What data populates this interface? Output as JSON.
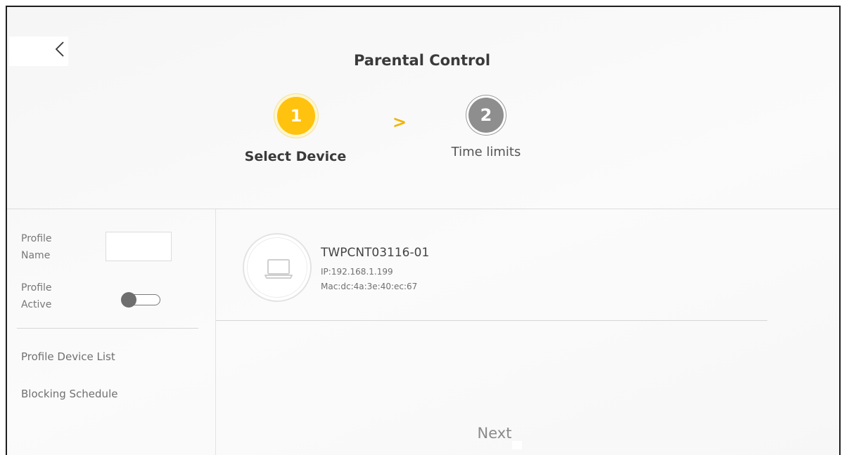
{
  "header": {
    "title": "Parental Control",
    "back_icon": "chevron-left-icon"
  },
  "steps": [
    {
      "number": "1",
      "label": "Select Device",
      "state": "active",
      "color": "#ffc20e"
    },
    {
      "number": "2",
      "label": "Time limits",
      "state": "inactive",
      "color": "#8e8e8e"
    }
  ],
  "step_separator": ">",
  "sidebar": {
    "profile_name_label": "Profile\nName",
    "profile_name_value": "",
    "profile_active_label": "Profile\nActive",
    "profile_active_on": false,
    "menu": [
      {
        "label": "Profile Device List"
      },
      {
        "label": "Blocking Schedule"
      }
    ]
  },
  "device": {
    "icon": "laptop-icon",
    "name": "TWPCNT03116-01",
    "ip": "IP:192.168.1.199",
    "mac": "Mac:dc:4a:3e:40:ec:67"
  },
  "footer": {
    "next_label": "Next"
  }
}
